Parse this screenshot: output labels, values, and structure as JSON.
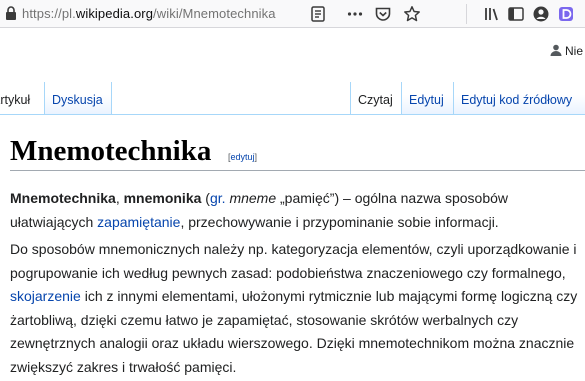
{
  "browser": {
    "url_prefix": "https://pl.",
    "url_domain": "wikipedia.org",
    "url_path": "/wiki/Mnemotechnika",
    "icons": [
      "lock-icon",
      "reader-view-icon",
      "more-icon",
      "pocket-icon",
      "bookmark-star-icon",
      "library-icon",
      "sidebar-icon",
      "account-icon",
      "extension-icon"
    ]
  },
  "personal": {
    "user_label": "Nie"
  },
  "tabs": {
    "artykul": "Artykuł",
    "dyskusja": "Dyskusja",
    "czytaj": "Czytaj",
    "edytuj": "Edytuj",
    "edytuj_kod": "Edytuj kod źródłowy"
  },
  "article": {
    "title": "Mnemotechnika",
    "edit_open": "[",
    "edit_link": "edytuj",
    "edit_close": "]",
    "p1": {
      "b1": "Mnemotechnika",
      "t1": ", ",
      "b2": "mnemonika",
      "t2": " (",
      "l1": "gr.",
      "t3": " ",
      "i1": "mneme",
      "t4": " „pamięć”) – ogólna nazwa sposobów",
      "line2_a": "ułatwiających ",
      "l2": "zapamiętanie",
      "line2_b": ", przechowywanie i przypominanie sobie informacji."
    },
    "p2": {
      "line1": "Do sposobów mnemonicznych należy np. kategoryzacja elementów, czyli uporządkowanie i",
      "line2": "pogrupowanie ich według pewnych zasad: podobieństwa znaczeniowego czy formalnego,",
      "l1": "skojarzenie",
      "line3": " ich z innymi elementami, ułożonymi rytmicznie lub mającymi formę logiczną czy",
      "line4": "żartobliwą, dzięki czemu łatwo je zapamiętać, stosowanie skrótów werbalnych czy",
      "line5": "zewnętrznych analogii oraz układu wierszowego. Dzięki mnemotechnikom można znacznie",
      "line6": "zwiększyć zakres i trwałość pamięci."
    }
  },
  "colors": {
    "link": "#0645ad",
    "text": "#202122",
    "tab_border": "#a7d7f9",
    "toolbar_bg": "#f9f9fa"
  }
}
